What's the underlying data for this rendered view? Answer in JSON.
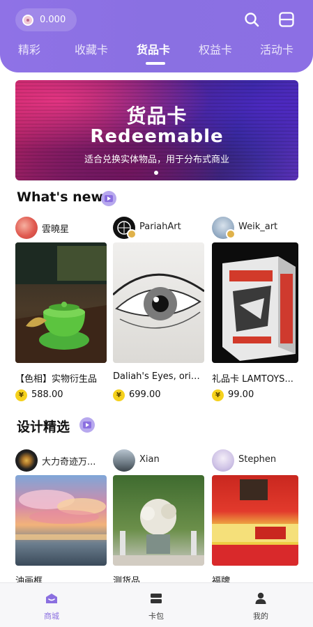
{
  "header": {
    "balance": "0.000",
    "tabs": [
      {
        "label": "精彩",
        "active": false
      },
      {
        "label": "收藏卡",
        "active": false
      },
      {
        "label": "货品卡",
        "active": true
      },
      {
        "label": "权益卡",
        "active": false
      },
      {
        "label": "活动卡",
        "active": false
      }
    ],
    "icons": {
      "search": "search-icon",
      "scan": "scan-icon"
    }
  },
  "banner": {
    "title": "货品卡",
    "subtitle": "Redeemable",
    "description": "适合兑换实体物品，用于分布式商业"
  },
  "whats_new": {
    "title": "What's new",
    "cards": [
      {
        "creator": "雲曉星",
        "name": "【色相】实物衍生品",
        "price": "588.00",
        "currency": "¥"
      },
      {
        "creator": "PariahArt",
        "name": "Daliah's Eyes, origi...",
        "price": "699.00",
        "currency": "¥"
      },
      {
        "creator": "Weik_art",
        "name": "礼品卡 LAMTOYS...",
        "price": "99.00",
        "currency": "¥"
      }
    ]
  },
  "design_picks": {
    "title": "设计精选",
    "cards": [
      {
        "creator": "大力奇迹万...",
        "name": "油画框"
      },
      {
        "creator": "Xian",
        "name": "测货品"
      },
      {
        "creator": "Stephen",
        "name": "福牌"
      }
    ]
  },
  "bottom_nav": [
    {
      "label": "商城",
      "icon": "mall-icon",
      "active": true
    },
    {
      "label": "卡包",
      "icon": "card-wallet-icon",
      "active": false
    },
    {
      "label": "我的",
      "icon": "profile-icon",
      "active": false
    }
  ],
  "colors": {
    "accent": "#8b6fe0",
    "coin": "#f5d11c"
  }
}
